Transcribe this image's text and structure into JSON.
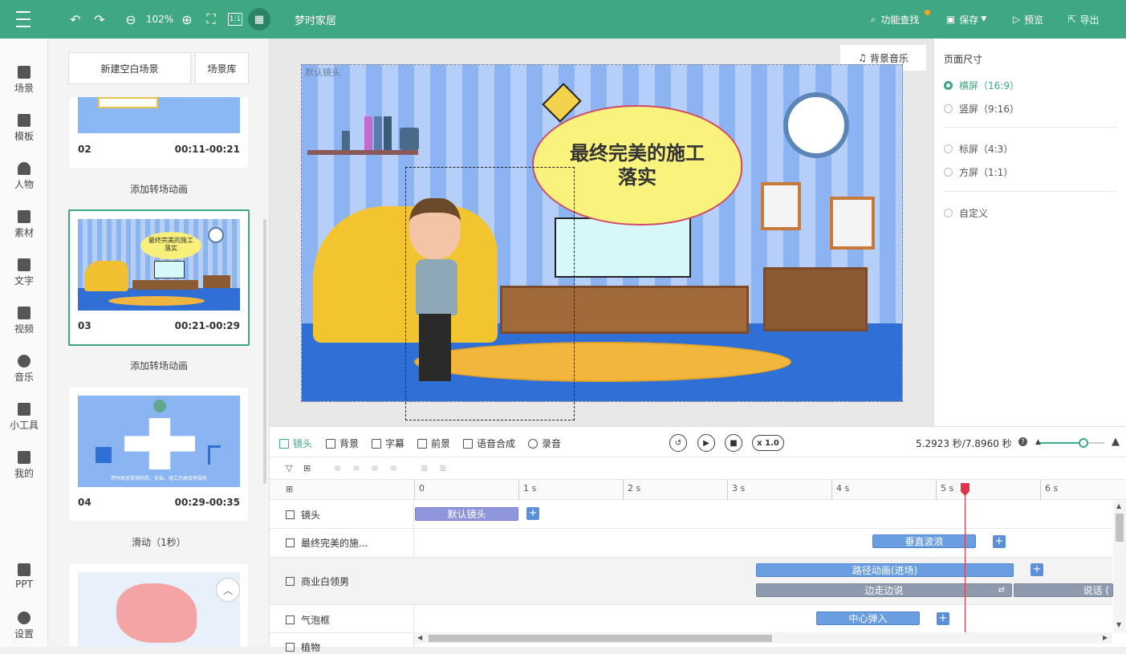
{
  "topbar": {
    "zoom": "102%",
    "project_title": "梦时家居",
    "feature_search": "功能查找",
    "save": "保存",
    "preview": "预览",
    "export": "导出"
  },
  "nav": {
    "items": [
      "场景",
      "模板",
      "人物",
      "素材",
      "文字",
      "视频",
      "音乐",
      "小工具",
      "我的"
    ],
    "ppt": "PPT",
    "settings": "设置"
  },
  "scenes": {
    "new_blank": "新建空白场景",
    "library": "场景库",
    "cards": [
      {
        "num": "02",
        "time": "00:11-00:21"
      },
      {
        "num": "03",
        "time": "00:21-00:29"
      },
      {
        "num": "04",
        "time": "00:29-00:35"
      }
    ],
    "transitions": [
      "添加转场动画",
      "添加转场动画",
      "滑动（1秒）"
    ],
    "thumb3_text": "最终完美的施工落实",
    "thumb4_text": "梦时家居提供制造、安装、施工的高效率服务"
  },
  "canvas": {
    "bg_music": "背景音乐",
    "default_camera": "默认镜头",
    "bubble_text": "最终完美的施工落实"
  },
  "page_size": {
    "title": "页面尺寸",
    "options": [
      "横屏（16:9）",
      "竖屏（9:16）",
      "标屏（4:3）",
      "方屏（1:1）",
      "自定义"
    ],
    "selected": "横屏（16:9）"
  },
  "timeline": {
    "tools": [
      "镜头",
      "背景",
      "字幕",
      "前景",
      "语音合成",
      "录音"
    ],
    "speed": "x 1.0",
    "time_readout": "5.2923 秒/7.8960 秒",
    "ruler": [
      "0",
      "1 s",
      "2 s",
      "3 s",
      "4 s",
      "5 s",
      "6 s"
    ],
    "tracks": [
      "镜头",
      "最终完美的施...",
      "商业白领男",
      "气泡框",
      "植物"
    ],
    "clips": {
      "camera": "默认镜头",
      "text": "垂直波浪",
      "man_1": "路径动画(进场)",
      "man_2": "边走边说",
      "man_3": "说话 (",
      "bubble": "中心弹入"
    }
  },
  "colors": {
    "brand": "#3fa782",
    "clip": "#6a9ee0",
    "playhead": "#e0334a"
  }
}
